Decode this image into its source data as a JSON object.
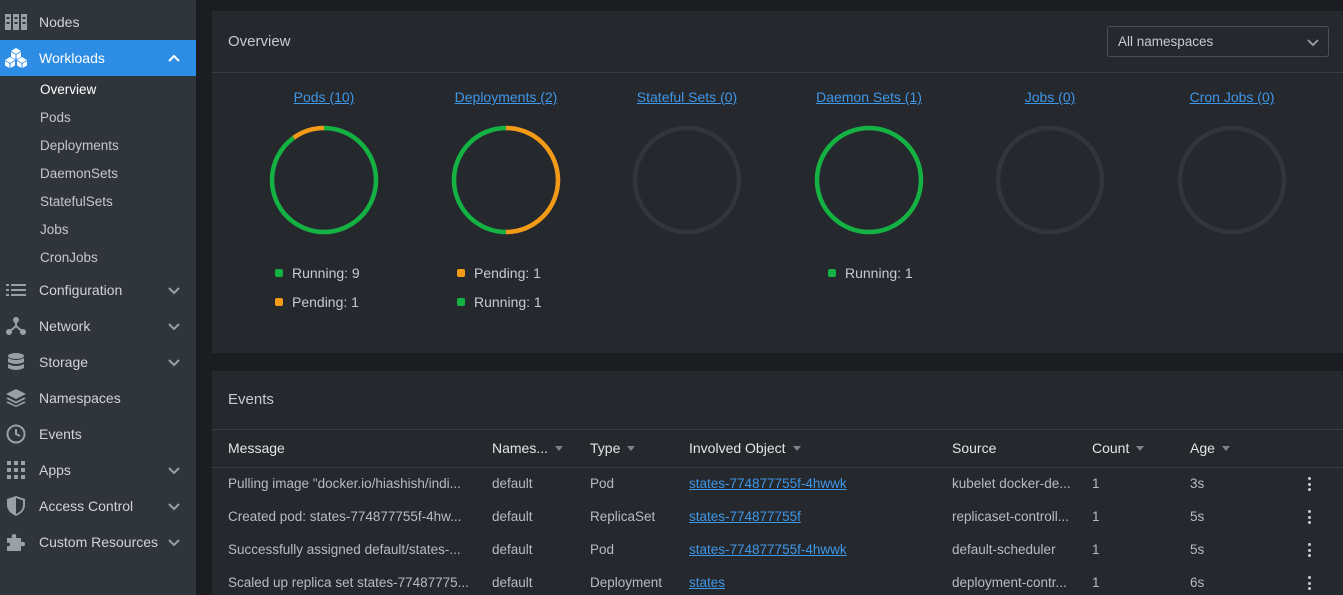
{
  "sidebar": {
    "items": [
      {
        "label": "Nodes",
        "icon": "nodes-icon"
      },
      {
        "label": "Workloads",
        "icon": "workloads-icon",
        "active": true
      },
      {
        "label": "Configuration",
        "icon": "list-icon"
      },
      {
        "label": "Network",
        "icon": "network-icon"
      },
      {
        "label": "Storage",
        "icon": "database-icon"
      },
      {
        "label": "Namespaces",
        "icon": "layers-icon"
      },
      {
        "label": "Events",
        "icon": "clock-icon"
      },
      {
        "label": "Apps",
        "icon": "grid-icon"
      },
      {
        "label": "Access Control",
        "icon": "shield-icon"
      },
      {
        "label": "Custom Resources",
        "icon": "puzzle-icon"
      }
    ],
    "workloads_sub": [
      "Overview",
      "Pods",
      "Deployments",
      "DaemonSets",
      "StatefulSets",
      "Jobs",
      "CronJobs"
    ]
  },
  "overview": {
    "title": "Overview",
    "namespace_select": "All namespaces",
    "workloads": [
      {
        "label": "Pods (10)",
        "segments": [
          {
            "status": "Running",
            "value": 9,
            "color": "#14b143"
          },
          {
            "status": "Pending",
            "value": 1,
            "color": "#f39a16"
          }
        ],
        "legend": [
          "Running: 9",
          "Pending: 1"
        ]
      },
      {
        "label": "Deployments (2)",
        "segments": [
          {
            "status": "Pending",
            "value": 1,
            "color": "#f39a16"
          },
          {
            "status": "Running",
            "value": 1,
            "color": "#14b143"
          }
        ],
        "legend": [
          "Pending: 1",
          "Running: 1"
        ]
      },
      {
        "label": "Stateful Sets (0)",
        "segments": [],
        "legend": []
      },
      {
        "label": "Daemon Sets (1)",
        "segments": [
          {
            "status": "Running",
            "value": 1,
            "color": "#14b143"
          }
        ],
        "legend": [
          "Running: 1"
        ]
      },
      {
        "label": "Jobs (0)",
        "segments": [],
        "legend": []
      },
      {
        "label": "Cron Jobs (0)",
        "segments": [],
        "legend": []
      }
    ]
  },
  "events": {
    "title": "Events",
    "columns": [
      "Message",
      "Names...",
      "Type",
      "Involved Object",
      "Source",
      "Count",
      "Age"
    ],
    "rows": [
      {
        "message": "Pulling image \"docker.io/hiashish/indi...",
        "namespace": "default",
        "type": "Pod",
        "object": "states-774877755f-4hwwk",
        "source": "kubelet docker-de...",
        "count": "1",
        "age": "3s"
      },
      {
        "message": "Created pod: states-774877755f-4hw...",
        "namespace": "default",
        "type": "ReplicaSet",
        "object": "states-774877755f",
        "source": "replicaset-controll...",
        "count": "1",
        "age": "5s"
      },
      {
        "message": "Successfully assigned default/states-...",
        "namespace": "default",
        "type": "Pod",
        "object": "states-774877755f-4hwwk",
        "source": "default-scheduler",
        "count": "1",
        "age": "5s"
      },
      {
        "message": "Scaled up replica set states-77487775...",
        "namespace": "default",
        "type": "Deployment",
        "object": "states",
        "source": "deployment-contr...",
        "count": "1",
        "age": "6s"
      }
    ]
  },
  "colors": {
    "accent": "#2d8ce3",
    "running": "#14b143",
    "pending": "#f39a16",
    "link": "#3f97e8"
  }
}
